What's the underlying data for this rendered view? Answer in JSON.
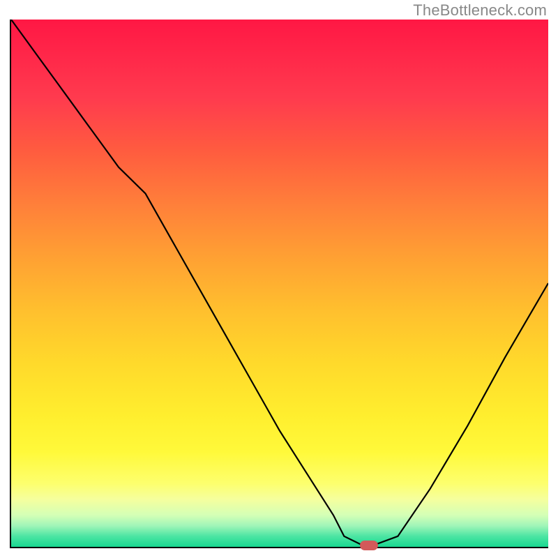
{
  "watermark": "TheBottleneck.com",
  "chart_data": {
    "type": "line",
    "title": "",
    "xlabel": "",
    "ylabel": "",
    "xlim": [
      0,
      100
    ],
    "ylim": [
      0,
      100
    ],
    "grid": false,
    "series": [
      {
        "name": "curve",
        "x": [
          0,
          5,
          10,
          15,
          20,
          25,
          30,
          35,
          40,
          45,
          50,
          55,
          60,
          62,
          65,
          68,
          72,
          78,
          85,
          92,
          100
        ],
        "y": [
          100,
          93,
          86,
          79,
          72,
          67,
          58,
          49,
          40,
          31,
          22,
          14,
          6,
          2,
          0.5,
          0.5,
          2,
          11,
          23,
          36,
          50
        ]
      }
    ],
    "marker": {
      "x": 66.5,
      "y": 0.5
    },
    "background_gradient": {
      "top": "#ff1744",
      "middle": "#ffd92b",
      "bottom": "#18d890"
    }
  }
}
